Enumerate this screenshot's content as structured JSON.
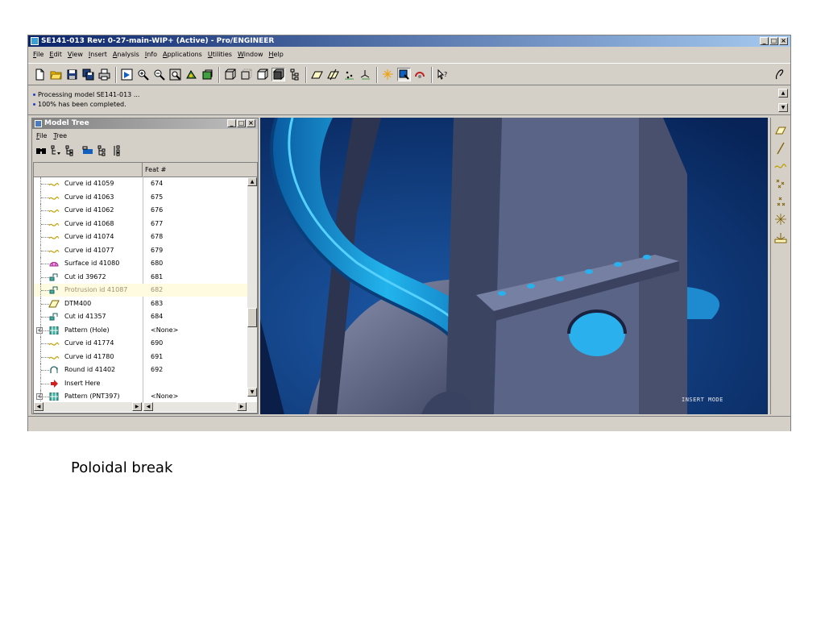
{
  "window": {
    "title": "SE141-013 Rev: 0-27-main-WIP+ (Active) - Pro/ENGINEER",
    "controls": [
      "_",
      "□",
      "×"
    ]
  },
  "menubar": [
    "File",
    "Edit",
    "View",
    "Insert",
    "Analysis",
    "Info",
    "Applications",
    "Utilities",
    "Window",
    "Help"
  ],
  "toolbar": {
    "icons": [
      "new-file-icon",
      "open-folder-icon",
      "save-icon",
      "save-copy-icon",
      "print-icon",
      "repaint-icon",
      "zoom-in-icon",
      "zoom-out-icon",
      "refit-icon",
      "orient-icon",
      "saved-views-icon",
      "wireframe-icon",
      "hidden-line-icon",
      "no-hidden-icon",
      "shading-icon",
      "model-tree-toggle-icon",
      "datum-planes-icon",
      "datum-axes-icon",
      "datum-points-icon",
      "coord-sys-icon",
      "spin-center-icon",
      "selection-filter-icon",
      "orient-mode-icon",
      "context-help-icon"
    ],
    "right_icon": "style-tools-icon"
  },
  "messages": [
    "Processing model SE141-013 ...",
    "100% has been completed."
  ],
  "model_tree": {
    "title": "Model Tree",
    "menu": [
      "File",
      "Tree"
    ],
    "column_header": "Feat #",
    "rows": [
      {
        "label": "Curve id 41059",
        "feat": "674",
        "type": "curve"
      },
      {
        "label": "Curve id 41063",
        "feat": "675",
        "type": "curve"
      },
      {
        "label": "Curve id 41062",
        "feat": "676",
        "type": "curve"
      },
      {
        "label": "Curve id 41068",
        "feat": "677",
        "type": "curve"
      },
      {
        "label": "Curve id 41074",
        "feat": "678",
        "type": "curve"
      },
      {
        "label": "Curve id 41077",
        "feat": "679",
        "type": "curve"
      },
      {
        "label": "Surface id 41080",
        "feat": "680",
        "type": "surface"
      },
      {
        "label": "Cut id 39672",
        "feat": "681",
        "type": "cut"
      },
      {
        "label": "Protrusion id 41087",
        "feat": "682",
        "type": "cut",
        "suppressed": true
      },
      {
        "label": "DTM400",
        "feat": "683",
        "type": "datum"
      },
      {
        "label": "Cut id 41357",
        "feat": "684",
        "type": "cut"
      },
      {
        "label": "Pattern (Hole)",
        "feat": "<None>",
        "type": "pattern",
        "expandable": true
      },
      {
        "label": "Curve id 41774",
        "feat": "690",
        "type": "curve"
      },
      {
        "label": "Curve id 41780",
        "feat": "691",
        "type": "curve"
      },
      {
        "label": "Round id 41402",
        "feat": "692",
        "type": "round"
      },
      {
        "label": "Insert Here",
        "feat": "",
        "type": "insert"
      },
      {
        "label": "Pattern (PNT397)",
        "feat": "<None>",
        "type": "pattern",
        "expandable": true
      }
    ]
  },
  "viewport": {
    "mode_text": "INSERT MODE",
    "background_color": "#0a2c6a",
    "part_color": "#1ea0dc",
    "bracket_color": "#56607e"
  },
  "right_toolbar": {
    "icons": [
      "datum-plane-tool-icon",
      "datum-axis-tool-icon",
      "datum-curve-tool-icon",
      "datum-point-tool-icon",
      "offset-point-tool-icon",
      "field-point-tool-icon",
      "coord-sys-tool-icon"
    ]
  },
  "caption": "Poloidal break"
}
